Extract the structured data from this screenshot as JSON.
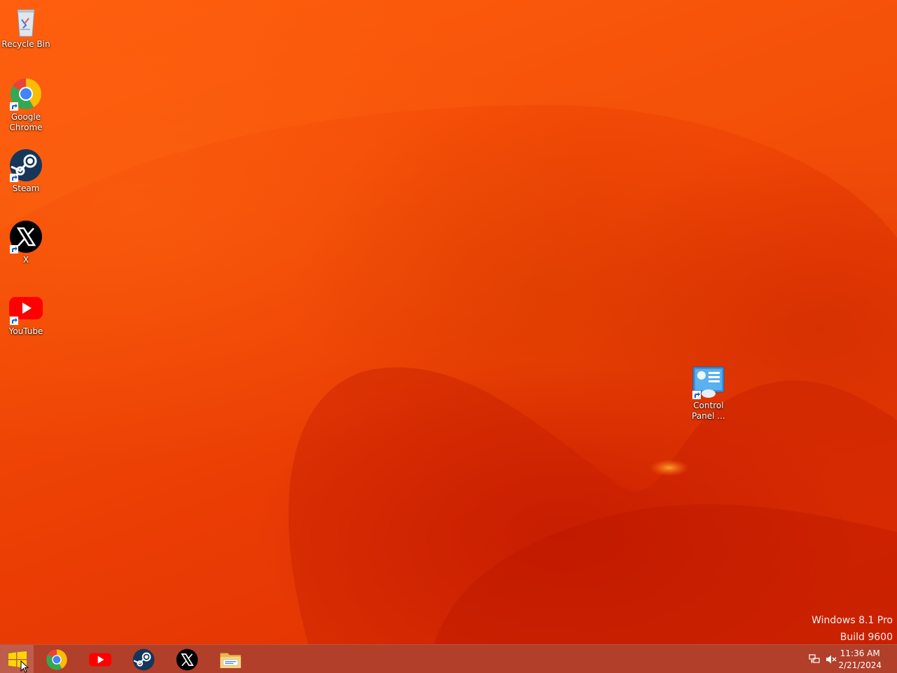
{
  "desktop": {
    "icons": [
      {
        "label": "Recycle Bin"
      },
      {
        "label": "Google Chrome"
      },
      {
        "label": "Steam"
      },
      {
        "label": "X"
      },
      {
        "label": "YouTube"
      },
      {
        "label": "Control Panel ..."
      }
    ],
    "watermark": {
      "line1": "Windows 8.1 Pro",
      "line2": "Build 9600"
    }
  },
  "taskbar": {
    "pinned": [
      "chrome-icon",
      "youtube-icon",
      "steam-icon",
      "x-icon",
      "file-explorer-icon"
    ],
    "clock": {
      "time": "11:36 AM",
      "date": "2/21/2024"
    }
  },
  "colors": {
    "wallpaper": "#f24a06",
    "taskbar": "#b13f2a",
    "chrome_red": "#ea4335",
    "chrome_yellow": "#fbbc05",
    "chrome_green": "#34a853",
    "chrome_blue": "#4285f4",
    "youtube_red": "#ff0000",
    "steam_blue": "#1b3a5e"
  }
}
